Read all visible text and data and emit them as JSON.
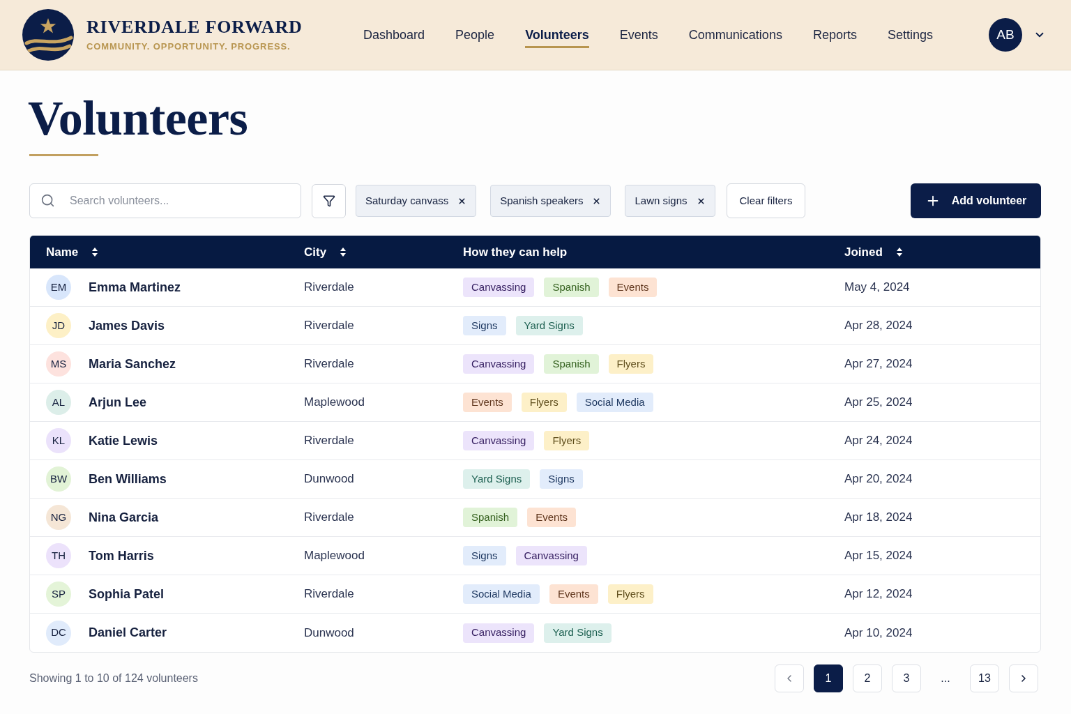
{
  "header": {
    "brand": {
      "title": "RIVERDALE FORWARD",
      "tagline": "COMMUNITY. OPPORTUNITY. PROGRESS."
    },
    "nav": [
      {
        "label": "Dashboard",
        "selected": false
      },
      {
        "label": "People",
        "selected": false
      },
      {
        "label": "Volunteers",
        "selected": true
      },
      {
        "label": "Events",
        "selected": false
      },
      {
        "label": "Communications",
        "selected": false
      },
      {
        "label": "Reports",
        "selected": false
      },
      {
        "label": "Settings",
        "selected": false
      }
    ],
    "user": {
      "initials": "AB"
    }
  },
  "page": {
    "title": "Volunteers"
  },
  "toolbar": {
    "search": {
      "placeholder": "Search volunteers..."
    },
    "filter_chips": [
      {
        "label": "Saturday canvass"
      },
      {
        "label": "Spanish speakers"
      },
      {
        "label": "Lawn signs"
      }
    ],
    "clear_button": "Clear filters",
    "add_button": "Add volunteer"
  },
  "table": {
    "columns": [
      {
        "label": "Name",
        "sortable": true
      },
      {
        "label": "City",
        "sortable": true
      },
      {
        "label": "How they can help",
        "sortable": false
      },
      {
        "label": "Joined",
        "sortable": true
      }
    ],
    "rows": [
      {
        "avatar": {
          "initials": "EM",
          "color": "#d8e6fb"
        },
        "name": "Emma Martinez",
        "city": "Riverdale",
        "tags": [
          {
            "label": "Canvassing",
            "color": "#ece4fb"
          },
          {
            "label": "Spanish",
            "color": "#e1f3d8"
          },
          {
            "label": "Events",
            "color": "#fde3d3"
          }
        ],
        "joined": "May 4, 2024"
      },
      {
        "avatar": {
          "initials": "JD",
          "color": "#fdf0c6"
        },
        "name": "James Davis",
        "city": "Riverdale",
        "tags": [
          {
            "label": "Signs",
            "color": "#e2ecfb"
          },
          {
            "label": "Yard Signs",
            "color": "#ddf0ec"
          }
        ],
        "joined": "Apr 28, 2024"
      },
      {
        "avatar": {
          "initials": "MS",
          "color": "#fde2de"
        },
        "name": "Maria Sanchez",
        "city": "Riverdale",
        "tags": [
          {
            "label": "Canvassing",
            "color": "#ece4fb"
          },
          {
            "label": "Spanish",
            "color": "#e1f3d8"
          },
          {
            "label": "Flyers",
            "color": "#fdf0c8"
          }
        ],
        "joined": "Apr 27, 2024"
      },
      {
        "avatar": {
          "initials": "AL",
          "color": "#dceee9"
        },
        "name": "Arjun Lee",
        "city": "Maplewood",
        "tags": [
          {
            "label": "Events",
            "color": "#fde3d3"
          },
          {
            "label": "Flyers",
            "color": "#fdf0c8"
          },
          {
            "label": "Social Media",
            "color": "#e2ecfb"
          }
        ],
        "joined": "Apr 25, 2024"
      },
      {
        "avatar": {
          "initials": "KL",
          "color": "#ebe2fb"
        },
        "name": "Katie Lewis",
        "city": "Riverdale",
        "tags": [
          {
            "label": "Canvassing",
            "color": "#ece4fb"
          },
          {
            "label": "Flyers",
            "color": "#fdf0c8"
          }
        ],
        "joined": "Apr 24, 2024"
      },
      {
        "avatar": {
          "initials": "BW",
          "color": "#e2f3d6"
        },
        "name": "Ben Williams",
        "city": "Dunwood",
        "tags": [
          {
            "label": "Yard Signs",
            "color": "#ddf0ec"
          },
          {
            "label": "Signs",
            "color": "#e2ecfb"
          }
        ],
        "joined": "Apr 20, 2024"
      },
      {
        "avatar": {
          "initials": "NG",
          "color": "#f5e6d6"
        },
        "name": "Nina Garcia",
        "city": "Riverdale",
        "tags": [
          {
            "label": "Spanish",
            "color": "#e1f3d8"
          },
          {
            "label": "Events",
            "color": "#fde3d3"
          }
        ],
        "joined": "Apr 18, 2024"
      },
      {
        "avatar": {
          "initials": "TH",
          "color": "#ece2fb"
        },
        "name": "Tom Harris",
        "city": "Maplewood",
        "tags": [
          {
            "label": "Signs",
            "color": "#e2ecfb"
          },
          {
            "label": "Canvassing",
            "color": "#ece4fb"
          }
        ],
        "joined": "Apr 15, 2024"
      },
      {
        "avatar": {
          "initials": "SP",
          "color": "#e4f4d8"
        },
        "name": "Sophia Patel",
        "city": "Riverdale",
        "tags": [
          {
            "label": "Social Media",
            "color": "#e2ecfb"
          },
          {
            "label": "Events",
            "color": "#fde3d3"
          },
          {
            "label": "Flyers",
            "color": "#fdf0c8"
          }
        ],
        "joined": "Apr 12, 2024"
      },
      {
        "avatar": {
          "initials": "DC",
          "color": "#e0ebfb"
        },
        "name": "Daniel Carter",
        "city": "Dunwood",
        "tags": [
          {
            "label": "Canvassing",
            "color": "#ece4fb"
          },
          {
            "label": "Yard Signs",
            "color": "#ddf0ec"
          }
        ],
        "joined": "Apr 10, 2024"
      }
    ]
  },
  "footer": {
    "summary": "Showing 1 to 10 of 124 volunteers",
    "pages": [
      {
        "kind": "page",
        "label": "1",
        "selected": true
      },
      {
        "kind": "page",
        "label": "2",
        "selected": false
      },
      {
        "kind": "page",
        "label": "3",
        "selected": false
      },
      {
        "kind": "ellipsis",
        "label": "...",
        "selected": false
      },
      {
        "kind": "page",
        "label": "13",
        "selected": false
      }
    ]
  }
}
